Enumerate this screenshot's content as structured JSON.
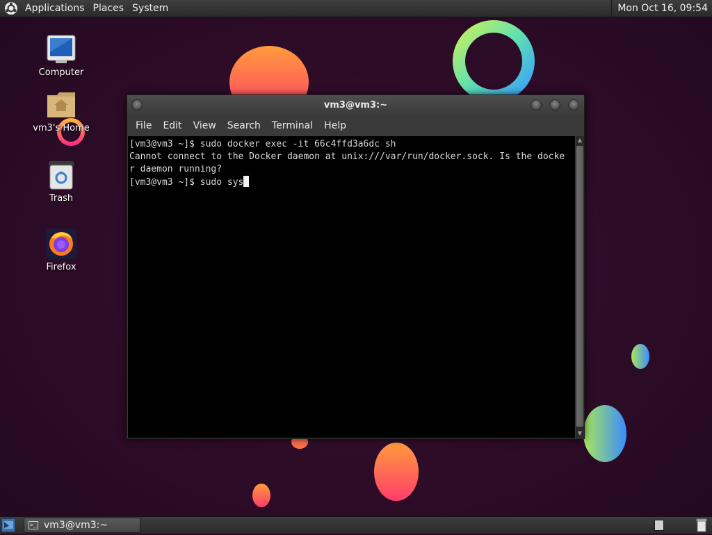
{
  "top_panel": {
    "menus": [
      "Applications",
      "Places",
      "System"
    ],
    "clock": "Mon Oct 16, 09:54"
  },
  "desktop": {
    "icons": [
      {
        "label": "Computer",
        "icon": "computer-icon"
      },
      {
        "label": "vm3's Home",
        "icon": "home-folder-icon"
      },
      {
        "label": "Trash",
        "icon": "trash-icon"
      },
      {
        "label": "Firefox",
        "icon": "firefox-icon"
      }
    ]
  },
  "terminal": {
    "title": "vm3@vm3:~",
    "menu": [
      "File",
      "Edit",
      "View",
      "Search",
      "Terminal",
      "Help"
    ],
    "lines": [
      "[vm3@vm3 ~]$ sudo docker exec -it 66c4ffd3a6dc sh",
      "Cannot connect to the Docker daemon at unix:///var/run/docker.sock. Is the docke",
      "r daemon running?"
    ],
    "prompt": "[vm3@vm3 ~]$ sudo sys"
  },
  "bottom_panel": {
    "taskbar_item": "vm3@vm3:~"
  },
  "colors": {
    "desktop_background": "#2e0c26",
    "panel": "#333333",
    "terminal_background": "#000000",
    "terminal_text": "#d8d8d8"
  }
}
